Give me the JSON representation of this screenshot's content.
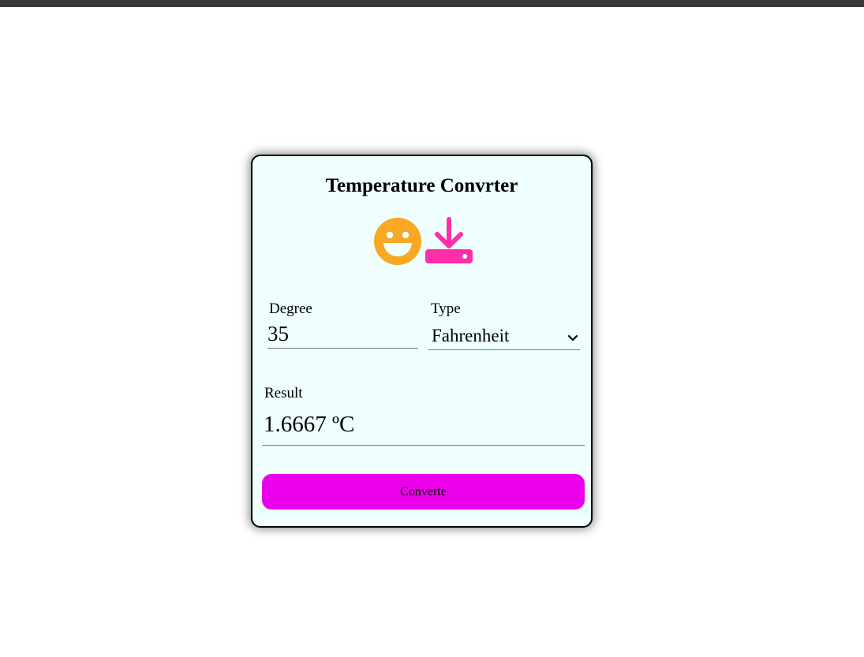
{
  "converter": {
    "title": "Temperature Convrter",
    "icons": {
      "left": "grinning-face-icon",
      "right": "download-icon",
      "smile_color": "#f9a825",
      "download_color": "#ff2ea9"
    },
    "degree": {
      "label": "Degree",
      "value": "35"
    },
    "type": {
      "label": "Type",
      "selected": "Fahrenheit"
    },
    "result": {
      "label": "Result",
      "value": "1.6667 ºC"
    },
    "convert_button": {
      "label": "Converte",
      "color": "#ec00ec"
    }
  }
}
